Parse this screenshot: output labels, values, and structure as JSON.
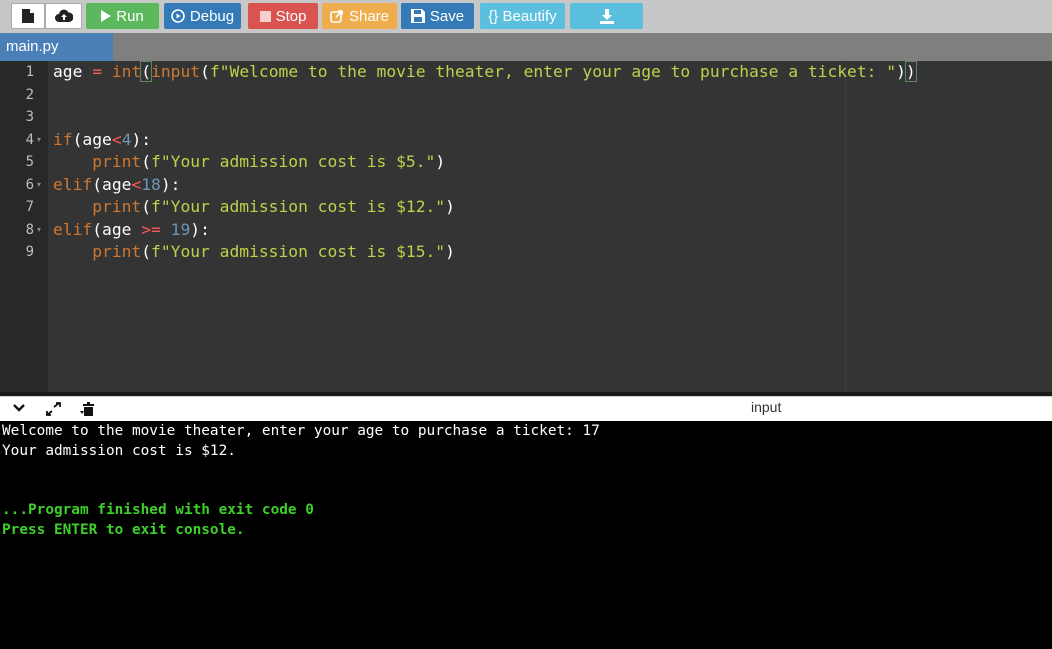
{
  "toolbar": {
    "new_icon": "new-file-icon",
    "open_icon": "upload-icon",
    "run": "Run",
    "debug": "Debug",
    "stop": "Stop",
    "share": "Share",
    "save": "Save",
    "beautify": "{} Beautify",
    "download_icon": "download-icon"
  },
  "tab": {
    "filename": "main.py"
  },
  "editor": {
    "line_numbers": [
      "1",
      "2",
      "3",
      "4",
      "5",
      "6",
      "7",
      "8",
      "9"
    ],
    "lines": [
      [
        [
          "t",
          "age "
        ],
        [
          "op",
          "="
        ],
        [
          "t",
          " "
        ],
        [
          "fn",
          "int"
        ],
        [
          "b",
          "("
        ],
        [
          "fn",
          "input"
        ],
        [
          "t",
          "("
        ],
        [
          "str",
          "f\"Welcome to the movie theater, enter your age to purchase a ticket: \""
        ],
        [
          "t",
          ")"
        ],
        [
          "b",
          ")"
        ]
      ],
      [],
      [],
      [
        [
          "kw",
          "if"
        ],
        [
          "t",
          "(age"
        ],
        [
          "op",
          "<"
        ],
        [
          "num",
          "4"
        ],
        [
          "t",
          "):"
        ]
      ],
      [
        [
          "t",
          "    "
        ],
        [
          "fn",
          "print"
        ],
        [
          "t",
          "("
        ],
        [
          "str",
          "f\"Your admission cost is $5.\""
        ],
        [
          "t",
          ")"
        ]
      ],
      [
        [
          "kw",
          "elif"
        ],
        [
          "t",
          "(age"
        ],
        [
          "op",
          "<"
        ],
        [
          "num",
          "18"
        ],
        [
          "t",
          "):"
        ]
      ],
      [
        [
          "t",
          "    "
        ],
        [
          "fn",
          "print"
        ],
        [
          "t",
          "("
        ],
        [
          "str",
          "f\"Your admission cost is $12.\""
        ],
        [
          "t",
          ")"
        ]
      ],
      [
        [
          "kw",
          "elif"
        ],
        [
          "t",
          "(age "
        ],
        [
          "op",
          ">="
        ],
        [
          "t",
          " "
        ],
        [
          "num",
          "19"
        ],
        [
          "t",
          "):"
        ]
      ],
      [
        [
          "t",
          "    "
        ],
        [
          "fn",
          "print"
        ],
        [
          "t",
          "("
        ],
        [
          "str",
          "f\"Your admission cost is $15.\""
        ],
        [
          "t",
          ")"
        ]
      ]
    ],
    "fold_lines": [
      4,
      6,
      8
    ]
  },
  "console_header": {
    "label": "input"
  },
  "console": {
    "output": [
      "Welcome to the movie theater, enter your age to purchase a ticket: 17",
      "Your admission cost is $12."
    ],
    "finished": "...Program finished with exit code 0",
    "press_enter": "Press ENTER to exit console."
  }
}
